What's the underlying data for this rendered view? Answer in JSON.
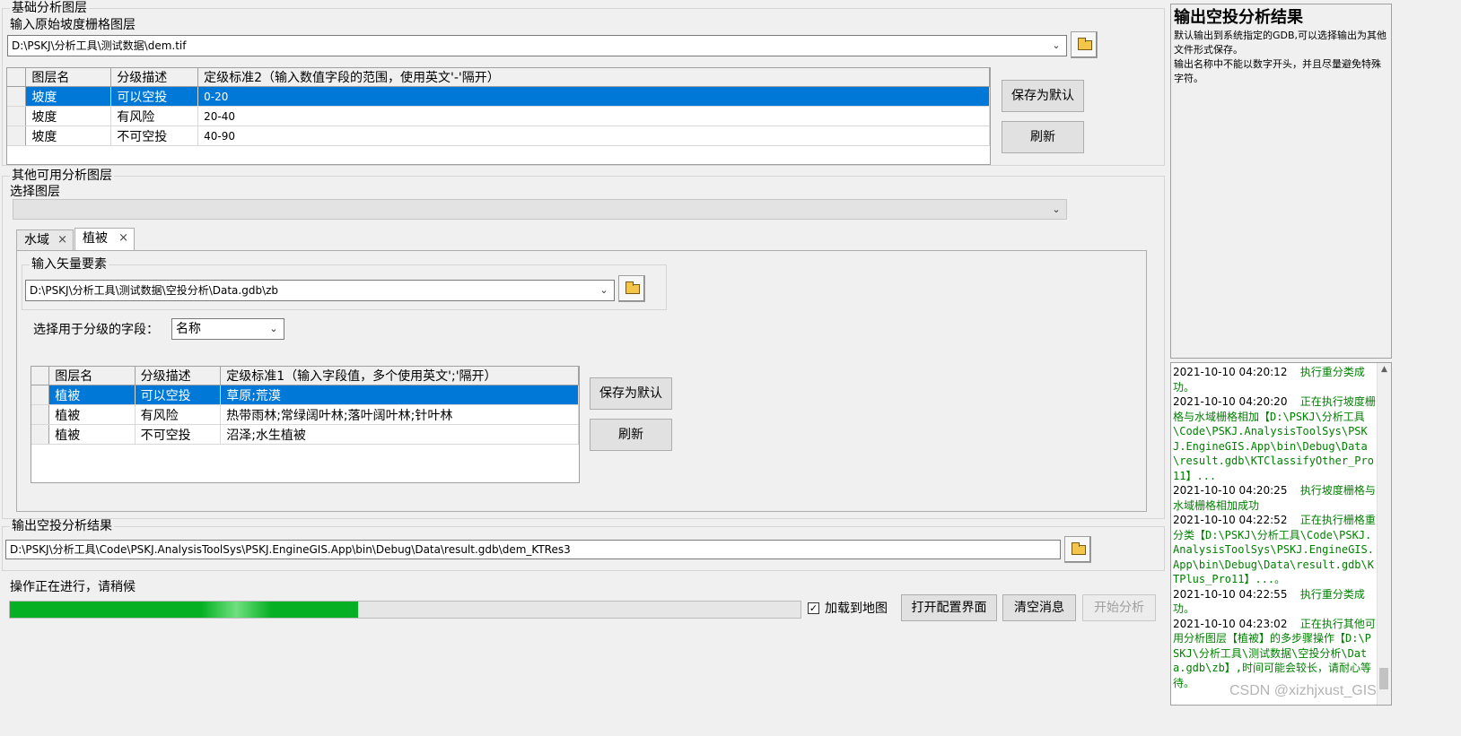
{
  "basic_group": {
    "title": "基础分析图层",
    "input_label": "输入原始坡度栅格图层",
    "input_value": "D:\\PSKJ\\分析工具\\测试数据\\dem.tif",
    "grid": {
      "headers": [
        "图层名",
        "分级描述",
        "定级标准2（输入数值字段的范围，使用英文'-'隔开）"
      ],
      "rows": [
        [
          "坡度",
          "可以空投",
          "0-20"
        ],
        [
          "坡度",
          "有风险",
          "20-40"
        ],
        [
          "坡度",
          "不可空投",
          "40-90"
        ]
      ]
    },
    "save_default": "保存为默认",
    "refresh": "刷新"
  },
  "other_group": {
    "title": "其他可用分析图层",
    "select_label": "选择图层",
    "select_value": "",
    "tabs": [
      {
        "label": "水域",
        "close": "×"
      },
      {
        "label": "植被",
        "close": "×"
      }
    ],
    "vector_group_title": "输入矢量要素",
    "vector_value": "D:\\PSKJ\\分析工具\\测试数据\\空投分析\\Data.gdb\\zb",
    "field_label": "选择用于分级的字段：",
    "field_value": "名称",
    "grid": {
      "headers": [
        "图层名",
        "分级描述",
        "定级标准1（输入字段值，多个使用英文';'隔开）"
      ],
      "rows": [
        [
          "植被",
          "可以空投",
          "草原;荒漠"
        ],
        [
          "植被",
          "有风险",
          "热带雨林;常绿阔叶林;落叶阔叶林;针叶林"
        ],
        [
          "植被",
          "不可空投",
          "沼泽;水生植被"
        ]
      ]
    },
    "save_default": "保存为默认",
    "refresh": "刷新"
  },
  "output_group": {
    "title": "输出空投分析结果",
    "path": "D:\\PSKJ\\分析工具\\Code\\PSKJ.AnalysisToolSys\\PSKJ.EngineGIS.App\\bin\\Debug\\Data\\result.gdb\\dem_KTRes3"
  },
  "status": {
    "text": "操作正在进行，请稍候",
    "progress_fraction": 0.44
  },
  "bottom": {
    "checkbox_label": "加载到地图",
    "checkbox_mark": "✓",
    "open_config": "打开配置界面",
    "clear_messages": "清空消息",
    "start_analysis": "开始分析"
  },
  "help": {
    "title": "输出空投分析结果",
    "body1": "默认输出到系统指定的GDB,可以选择输出为其他文件形式保存。",
    "body2": "输出名称中不能以数字开头，并且尽量避免特殊字符。"
  },
  "log": [
    {
      "time": "2021-10-10 04:20:12",
      "msg": "执行重分类成功。"
    },
    {
      "time": "2021-10-10 04:20:20",
      "msg": "正在执行坡度栅格与水域栅格相加【D:\\PSKJ\\分析工具\\Code\\PSKJ.AnalysisToolSys\\PSKJ.EngineGIS.App\\bin\\Debug\\Data\\result.gdb\\KTClassifyOther_Pro11】..."
    },
    {
      "time": "2021-10-10 04:20:25",
      "msg": "执行坡度栅格与水域栅格相加成功"
    },
    {
      "time": "2021-10-10 04:22:52",
      "msg": "正在执行栅格重分类【D:\\PSKJ\\分析工具\\Code\\PSKJ.AnalysisToolSys\\PSKJ.EngineGIS.App\\bin\\Debug\\Data\\result.gdb\\KTPlus_Pro11】...。"
    },
    {
      "time": "2021-10-10 04:22:55",
      "msg": "执行重分类成功。"
    },
    {
      "time": "2021-10-10 04:23:02",
      "msg": "正在执行其他可用分析图层【植被】的多步骤操作【D:\\PSKJ\\分析工具\\测试数据\\空投分析\\Data.gdb\\zb】,时间可能会较长，请耐心等待。"
    }
  ],
  "watermark": "CSDN @xizhjxust_GIS"
}
